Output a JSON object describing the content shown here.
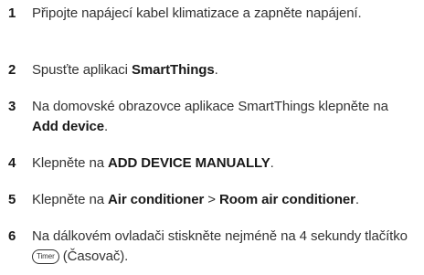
{
  "steps": [
    {
      "num": "1",
      "text": "Připojte napájecí kabel klimatizace a zapněte napájení."
    },
    {
      "num": "2",
      "pre": "Spusťte aplikaci ",
      "bold": "SmartThings",
      "post": "."
    },
    {
      "num": "3",
      "pre": "Na domovské obrazovce aplikace SmartThings klepněte na ",
      "bold": "Add device",
      "post": "."
    },
    {
      "num": "4",
      "pre": "Klepněte na ",
      "bold": "ADD DEVICE MANUALLY",
      "post": "."
    },
    {
      "num": "5",
      "pre": "Klepněte na ",
      "bold1": "Air conditioner",
      "sep": " > ",
      "bold2": "Room air conditioner",
      "post": "."
    },
    {
      "num": "6",
      "pre": "Na dálkovém ovladači stiskněte nejméně na 4 sekundy tlačítko ",
      "button": "Timer",
      "post": " (Časovač)."
    }
  ]
}
